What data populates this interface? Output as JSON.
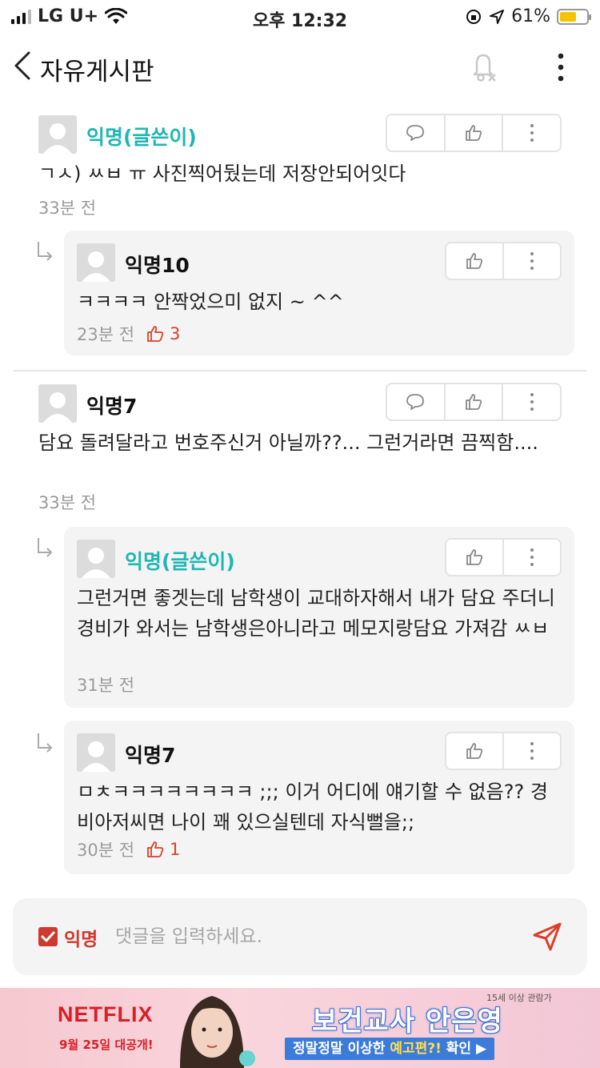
{
  "status_bar": {
    "carrier": "LG U+",
    "time": "오후 12:32",
    "battery": "61%",
    "battery_level": 0.61
  },
  "header": {
    "title": "자유게시판"
  },
  "comments": [
    {
      "author": "익명(글쓴이)",
      "is_op": true,
      "text": "ㄱㅅ) ㅆㅂ ㅠ  사진찍어뒀는데 저장안되어잇다",
      "time": "33분 전",
      "likes": ""
    },
    {
      "author": "익명10",
      "is_op": false,
      "text": "ㅋㅋㅋㅋ 안짝었으미 없지 ~ ^^",
      "time": "23분 전",
      "likes": "3"
    },
    {
      "author": "익명7",
      "is_op": false,
      "text": "담요 돌려달라고 번호주신거 아닐까??... 그런거라면 끔찍함....",
      "time": "33분 전",
      "likes": ""
    },
    {
      "author": "익명(글쓴이)",
      "is_op": true,
      "text": "그런거면 좋겟는데 남학생이 교대하자해서 내가 담요 주더니 경비가 와서는 남학생은아니라고 메모지랑담요 가져감 ㅆㅂ",
      "time": "31분 전",
      "likes": ""
    },
    {
      "author": "익명7",
      "is_op": false,
      "text": "ㅁㅊㅋㅋㅋㅋㅋㅋㅋㅋ ;;; 이거 어디에 얘기할 수 없음?? 경비아저씨면 나이 꽤 있으실텐데 자식뻘을;;",
      "time": "30분 전",
      "likes": "1"
    }
  ],
  "input_bar": {
    "anon_label": "익명",
    "placeholder": "댓글을 입력하세요.",
    "anon_checked": true
  },
  "ad": {
    "brand": "NETFLIX",
    "date": "9월 25일 대공개!",
    "rating": "15세 이상 관람가",
    "title": "보건교사 안은영",
    "cta_prefix": "정말정말 이상한 ",
    "cta_highlight": "예고편?!",
    "cta_suffix": " 확인 ▶"
  },
  "colors": {
    "op_author": "#20b7b3",
    "like": "#d9402a",
    "anon": "#cf3a2f",
    "netflix": "#d81f26"
  }
}
